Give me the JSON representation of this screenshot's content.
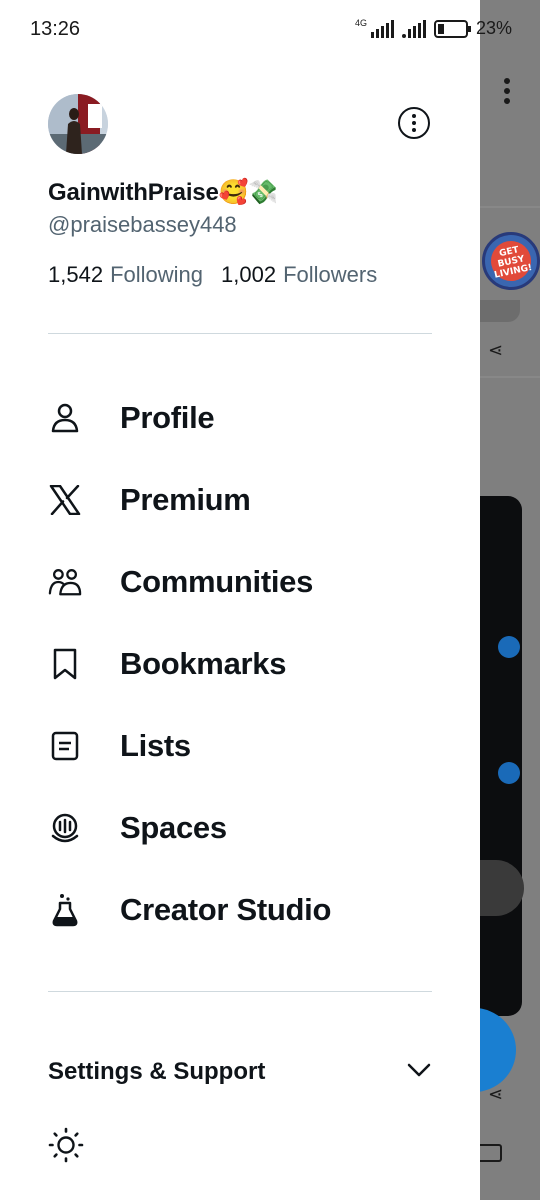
{
  "status_bar": {
    "time": "13:26",
    "network": "4G",
    "battery_percent": "23%",
    "battery_level": 0.23
  },
  "profile": {
    "display_name": "GainwithPraise🥰💸",
    "handle": "@praisebassey448",
    "following_count": "1,542",
    "following_label": "Following",
    "followers_count": "1,002",
    "followers_label": "Followers"
  },
  "menu": {
    "items": [
      {
        "label": "Profile",
        "icon": "person-icon"
      },
      {
        "label": "Premium",
        "icon": "x-logo-icon"
      },
      {
        "label": "Communities",
        "icon": "communities-icon"
      },
      {
        "label": "Bookmarks",
        "icon": "bookmark-icon"
      },
      {
        "label": "Lists",
        "icon": "list-icon"
      },
      {
        "label": "Spaces",
        "icon": "spaces-icon"
      },
      {
        "label": "Creator Studio",
        "icon": "flask-icon"
      }
    ]
  },
  "settings": {
    "label": "Settings & Support"
  },
  "background": {
    "sticker_text": "GET BUSY LIVING!"
  },
  "colors": {
    "text_primary": "#0f1419",
    "text_secondary": "#536471",
    "divider": "#cfd9de",
    "overlay": "#7f7f7f",
    "fab_blue": "#1a7fd1"
  }
}
